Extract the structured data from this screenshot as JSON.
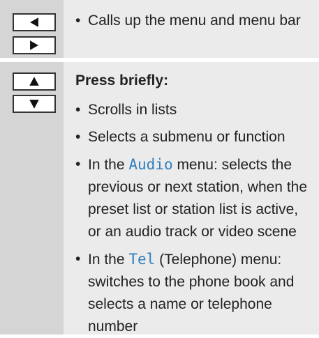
{
  "rows": [
    {
      "keys": [
        "left-arrow-icon",
        "right-arrow-icon"
      ],
      "items": [
        "Calls up the menu and menu bar"
      ]
    },
    {
      "keys": [
        "up-arrow-icon",
        "down-arrow-icon"
      ],
      "heading": "Press briefly:",
      "items": [
        "Scrolls in lists",
        "Selects a submenu or function"
      ],
      "audio_item": {
        "prefix": "In the ",
        "highlight": "Audio",
        "suffix": " menu: selects the previous or next station, when the preset list or station list is active, or an audio track or video scene"
      },
      "tel_item": {
        "prefix": "In the ",
        "highlight": "Tel",
        "suffix": " (Telephone) menu: switches to the phone book and selects a name or telephone number"
      }
    }
  ],
  "colors": {
    "key_column": "#d5d5d5",
    "text_column": "#ebebeb",
    "highlight": "#2e7fc0"
  }
}
